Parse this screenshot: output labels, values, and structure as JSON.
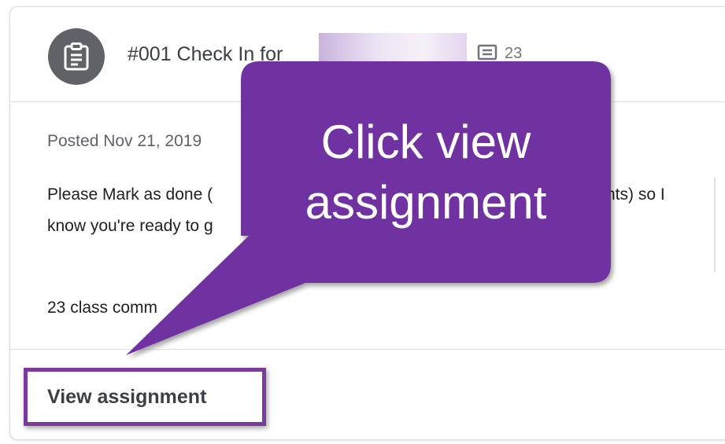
{
  "assignment": {
    "title": "#001 Check In for",
    "comment_count": "23",
    "posted": "Posted Nov 21, 2019",
    "description_line1_start": "Please Mark as done (",
    "description_line1_end": "nts) so I",
    "description_line2": "know you're ready to g",
    "class_comments": "23 class comm",
    "view_button_label": "View assignment"
  },
  "callout": {
    "text_line1": "Click view",
    "text_line2": "assignment",
    "fill_color": "#7030a0"
  },
  "icons": {
    "avatar": "assignment-clipboard-icon",
    "comments": "comment-icon"
  }
}
